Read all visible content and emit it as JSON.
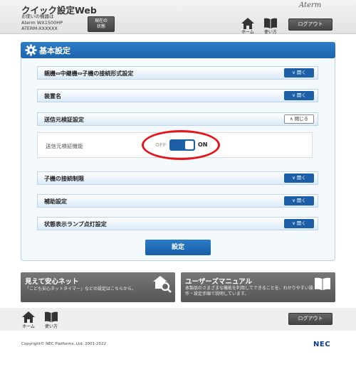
{
  "header": {
    "app_title": "クイック設定Web",
    "device_prefix": "お使いの機器は",
    "device_model": "Aterm WX1500HP",
    "device_name": "ATERM-XXXXXX",
    "status_button_line1": "現在の",
    "status_button_line2": "状態",
    "brand_logo": "Aterm",
    "nav": {
      "home_label": "ホーム",
      "manual_label": "使い方",
      "logout_label": "ログアウト"
    }
  },
  "panel": {
    "title": "基本設定",
    "sections": [
      {
        "label": "親機⇔中継機⇔子機の接続形式設定",
        "action": "開く"
      },
      {
        "label": "装置名",
        "action": "開く"
      },
      {
        "label": "送信元検証設定",
        "action": "閉じる"
      },
      {
        "label": "子機の接続制限",
        "action": "開く"
      },
      {
        "label": "補助設定",
        "action": "開く"
      },
      {
        "label": "状態表示ランプ点灯設定",
        "action": "開く"
      }
    ],
    "source_check": {
      "label": "送信元検証機能",
      "off_label": "OFF",
      "on_label": "ON",
      "state": "ON"
    },
    "apply_button": "設定"
  },
  "cards": {
    "safety": {
      "title": "見えて安心ネット",
      "desc": "「こども安心ネットタイマー」などの設定はこちらから。"
    },
    "manual": {
      "title": "ユーザーズマニュアル",
      "desc_line1": "本製品のさまざまな機能を利用してできることを、わかりやすい操",
      "desc_line2": "作・設定手順で説明しています。"
    }
  },
  "footer": {
    "home_label": "ホーム",
    "manual_label": "使い方",
    "logout_label": "ログアウト",
    "copyright": "Copyright© NEC Platforms, Ltd. 2001-2022",
    "nec_logo": "NEC"
  },
  "colors": {
    "accent": "#1d64ac",
    "highlight": "#e5161c"
  }
}
